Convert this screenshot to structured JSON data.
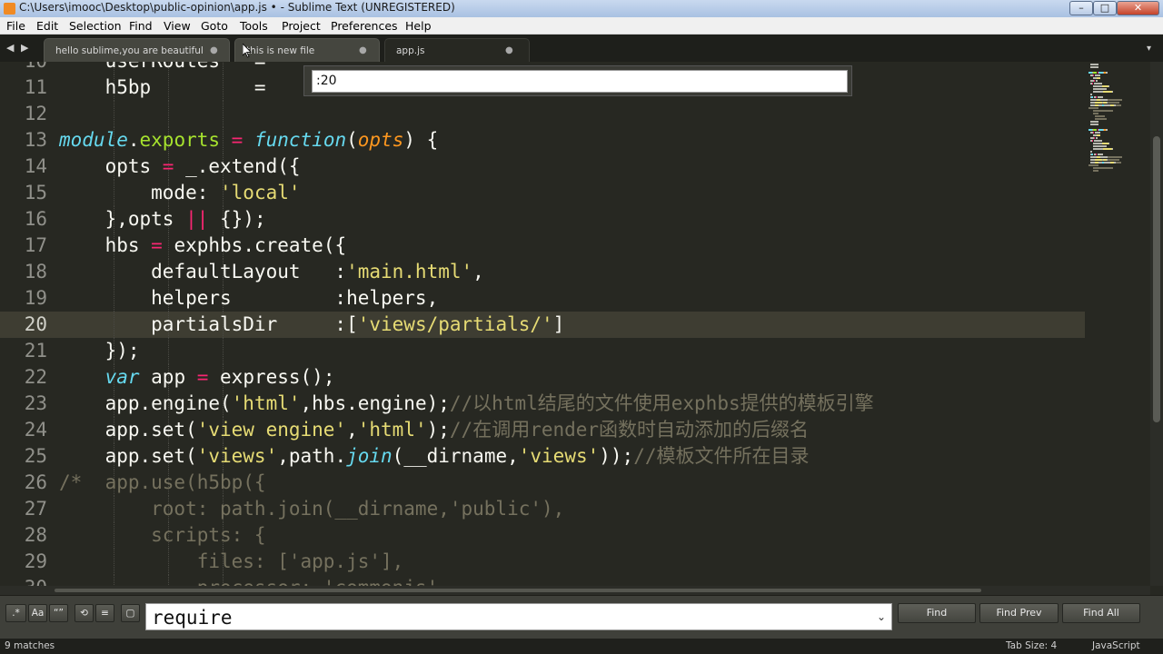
{
  "window": {
    "title": "C:\\Users\\imooc\\Desktop\\public-opinion\\app.js • - Sublime Text (UNREGISTERED)",
    "minimize_glyph": "–",
    "maximize_glyph": "□",
    "close_glyph": "✕"
  },
  "menu": [
    "File",
    "Edit",
    "Selection",
    "Find",
    "View",
    "Goto",
    "Tools",
    "Project",
    "Preferences",
    "Help"
  ],
  "tabs": {
    "nav_left": "◀",
    "nav_right": "▶",
    "items": [
      {
        "label": "hello sublime,you are beautiful",
        "dirty": "●"
      },
      {
        "label": "this is new file",
        "dirty": "●"
      },
      {
        "label": "app.js",
        "dirty": "●"
      }
    ],
    "overflow": "▾"
  },
  "goto": {
    "value": ":20"
  },
  "editor": {
    "current_line": "20",
    "lines": [
      {
        "num": "10",
        "tokens": [
          {
            "t": "    userRoutes   = ",
            "c": "plain"
          }
        ]
      },
      {
        "num": "11",
        "tokens": [
          {
            "t": "    h5bp         = ",
            "c": "plain"
          }
        ]
      },
      {
        "num": "12",
        "tokens": []
      },
      {
        "num": "13",
        "tokens": [
          {
            "t": "module",
            "c": "kw"
          },
          {
            "t": ".",
            "c": "plain"
          },
          {
            "t": "exports",
            "c": "fn"
          },
          {
            "t": " = ",
            "c": "op"
          },
          {
            "t": "function",
            "c": "kw"
          },
          {
            "t": "(",
            "c": "plain"
          },
          {
            "t": "opts",
            "c": "param"
          },
          {
            "t": ") {",
            "c": "plain"
          }
        ]
      },
      {
        "num": "14",
        "tokens": [
          {
            "t": "    opts ",
            "c": "plain"
          },
          {
            "t": "=",
            "c": "op"
          },
          {
            "t": " _.extend({",
            "c": "plain"
          }
        ]
      },
      {
        "num": "15",
        "tokens": [
          {
            "t": "        mode: ",
            "c": "plain"
          },
          {
            "t": "'local'",
            "c": "str"
          }
        ]
      },
      {
        "num": "16",
        "tokens": [
          {
            "t": "    },opts ",
            "c": "plain"
          },
          {
            "t": "||",
            "c": "op"
          },
          {
            "t": " {});",
            "c": "plain"
          }
        ]
      },
      {
        "num": "17",
        "tokens": [
          {
            "t": "    hbs ",
            "c": "plain"
          },
          {
            "t": "=",
            "c": "op"
          },
          {
            "t": " exphbs.create({",
            "c": "plain"
          }
        ]
      },
      {
        "num": "18",
        "tokens": [
          {
            "t": "        defaultLayout   :",
            "c": "plain"
          },
          {
            "t": "'main.html'",
            "c": "str"
          },
          {
            "t": ",",
            "c": "plain"
          }
        ]
      },
      {
        "num": "19",
        "tokens": [
          {
            "t": "        helpers         :helpers,",
            "c": "plain"
          }
        ]
      },
      {
        "num": "20",
        "tokens": [
          {
            "t": "        partialsDir     :[",
            "c": "plain"
          },
          {
            "t": "'views/partials/'",
            "c": "str"
          },
          {
            "t": "]",
            "c": "plain"
          }
        ]
      },
      {
        "num": "21",
        "tokens": [
          {
            "t": "    });",
            "c": "plain"
          }
        ]
      },
      {
        "num": "22",
        "tokens": [
          {
            "t": "    ",
            "c": "plain"
          },
          {
            "t": "var",
            "c": "kw"
          },
          {
            "t": " app ",
            "c": "plain"
          },
          {
            "t": "=",
            "c": "op"
          },
          {
            "t": " express();",
            "c": "plain"
          }
        ]
      },
      {
        "num": "23",
        "tokens": [
          {
            "t": "    app.engine(",
            "c": "plain"
          },
          {
            "t": "'html'",
            "c": "str"
          },
          {
            "t": ",hbs.engine);",
            "c": "plain"
          },
          {
            "t": "//以html结尾的文件使用exphbs提供的模板引擎",
            "c": "comment"
          }
        ]
      },
      {
        "num": "24",
        "tokens": [
          {
            "t": "    app.set(",
            "c": "plain"
          },
          {
            "t": "'view engine'",
            "c": "str"
          },
          {
            "t": ",",
            "c": "plain"
          },
          {
            "t": "'html'",
            "c": "str"
          },
          {
            "t": ");",
            "c": "plain"
          },
          {
            "t": "//在调用render函数时自动添加的后缀名",
            "c": "comment"
          }
        ]
      },
      {
        "num": "25",
        "tokens": [
          {
            "t": "    app.set(",
            "c": "plain"
          },
          {
            "t": "'views'",
            "c": "str"
          },
          {
            "t": ",path.",
            "c": "plain"
          },
          {
            "t": "join",
            "c": "kw"
          },
          {
            "t": "(__dirname,",
            "c": "plain"
          },
          {
            "t": "'views'",
            "c": "str"
          },
          {
            "t": "));",
            "c": "plain"
          },
          {
            "t": "//模板文件所在目录",
            "c": "comment"
          }
        ]
      },
      {
        "num": "26",
        "tokens": [
          {
            "t": "/*  app.use(h5bp({",
            "c": "comment"
          }
        ]
      },
      {
        "num": "27",
        "tokens": [
          {
            "t": "        root: path.join(__dirname,'public'),",
            "c": "comment"
          }
        ]
      },
      {
        "num": "28",
        "tokens": [
          {
            "t": "        scripts: {",
            "c": "comment"
          }
        ]
      },
      {
        "num": "29",
        "tokens": [
          {
            "t": "            files: ['app.js'],",
            "c": "comment"
          }
        ]
      },
      {
        "num": "30",
        "tokens": [
          {
            "t": "            processor: 'commonjs'",
            "c": "comment"
          }
        ]
      }
    ]
  },
  "find": {
    "option_regex": ".*",
    "option_case": "Aa",
    "option_word": "“”",
    "option_wrap": "⟲",
    "option_insel": "≡",
    "option_highlight": "▢",
    "value": "require",
    "dropdown": "⌄",
    "find_label": "Find",
    "find_prev_label": "Find Prev",
    "find_all_label": "Find All"
  },
  "status": {
    "matches": "9 matches",
    "tab_size": "Tab Size: 4",
    "syntax": "JavaScript"
  },
  "colors": {
    "background": "#272822",
    "keyword": "#66d9ef",
    "string": "#e6db74",
    "operator": "#f92672",
    "function": "#a6e22e",
    "parameter": "#fd971f",
    "comment": "#75715e"
  }
}
